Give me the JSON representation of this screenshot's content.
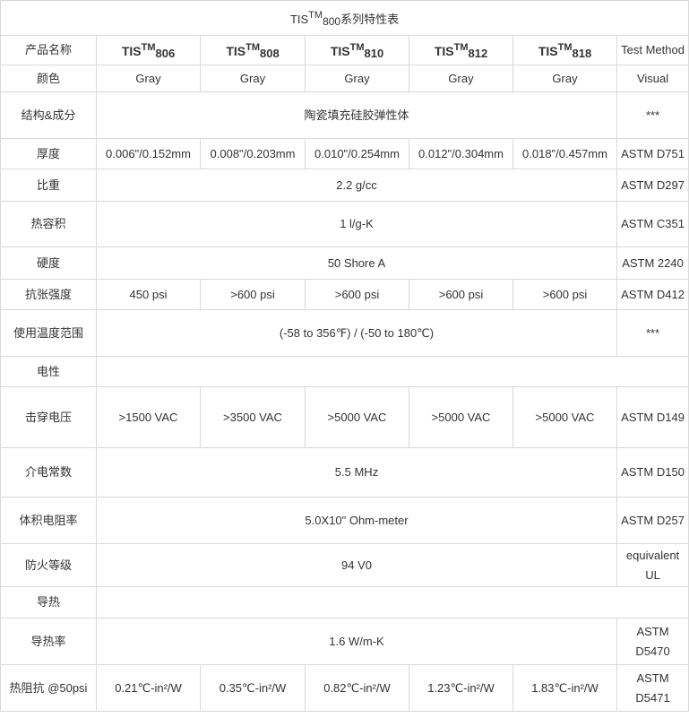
{
  "title": {
    "brand": "TIS",
    "tm": "TM",
    "num": "800",
    "rest": "系列特性表"
  },
  "header": {
    "first": "产品名称",
    "products": [
      {
        "brand": "TIS",
        "tm": "TM",
        "num": "806"
      },
      {
        "brand": "TIS",
        "tm": "TM",
        "num": "808"
      },
      {
        "brand": "TIS",
        "tm": "TM",
        "num": "810"
      },
      {
        "brand": "TIS",
        "tm": "TM",
        "num": "812"
      },
      {
        "brand": "TIS",
        "tm": "TM",
        "num": "818"
      }
    ],
    "method": "Test Method"
  },
  "color": {
    "label": "颜色",
    "values": [
      "Gray",
      "Gray",
      "Gray",
      "Gray",
      "Gray"
    ],
    "method": "Visual"
  },
  "structure": {
    "label": "结构&成分",
    "value": "陶瓷填充硅胶弹性体",
    "method": "***"
  },
  "thickness": {
    "label": "厚度",
    "values": [
      "0.006\"/0.152mm",
      "0.008\"/0.203mm",
      "0.010\"/0.254mm",
      "0.012\"/0.304mm",
      "0.018\"/0.457mm"
    ],
    "method": "ASTM D751"
  },
  "specific_gravity": {
    "label": "比重",
    "value": "2.2 g/cc",
    "method": "ASTM D297"
  },
  "heat_capacity": {
    "label": "热容积",
    "value": "1 l/g-K",
    "method": "ASTM C351"
  },
  "hardness": {
    "label": "硬度",
    "value": "50 Shore A",
    "method": "ASTM 2240"
  },
  "tensile": {
    "label": "抗张强度",
    "values": [
      "450 psi",
      ">600 psi",
      ">600 psi",
      ">600 psi",
      ">600 psi"
    ],
    "method": "ASTM D412"
  },
  "temp_range": {
    "label": "使用温度范围",
    "value": "(-58 to 356℉) / (-50 to 180℃)",
    "method": "***"
  },
  "electrical": {
    "label": "电性"
  },
  "breakdown": {
    "label": "击穿电压",
    "values": [
      ">1500 VAC",
      ">3500 VAC",
      ">5000 VAC",
      ">5000 VAC",
      ">5000 VAC"
    ],
    "method": "ASTM D149"
  },
  "dielectric": {
    "label": "介电常数",
    "value": "5.5 MHz",
    "method": "ASTM D150"
  },
  "volume_resistivity": {
    "label": "体积电阻率",
    "value": "5.0X10\" Ohm-meter",
    "method": "ASTM D257"
  },
  "flame": {
    "label": "防火等级",
    "value": "94 V0",
    "method_line1": "equivalent",
    "method_line2": "UL"
  },
  "thermal": {
    "label": "导热"
  },
  "conductivity": {
    "label": "导热率",
    "value": "1.6 W/m-K",
    "method_line1": "ASTM",
    "method_line2": "D5470"
  },
  "impedance": {
    "label": "热阻抗 @50psi",
    "values": [
      "0.21℃-in²/W",
      "0.35℃-in²/W",
      "0.82℃-in²/W",
      "1.23℃-in²/W",
      "1.83℃-in²/W"
    ],
    "method_line1": "ASTM",
    "method_line2": "D5471"
  }
}
